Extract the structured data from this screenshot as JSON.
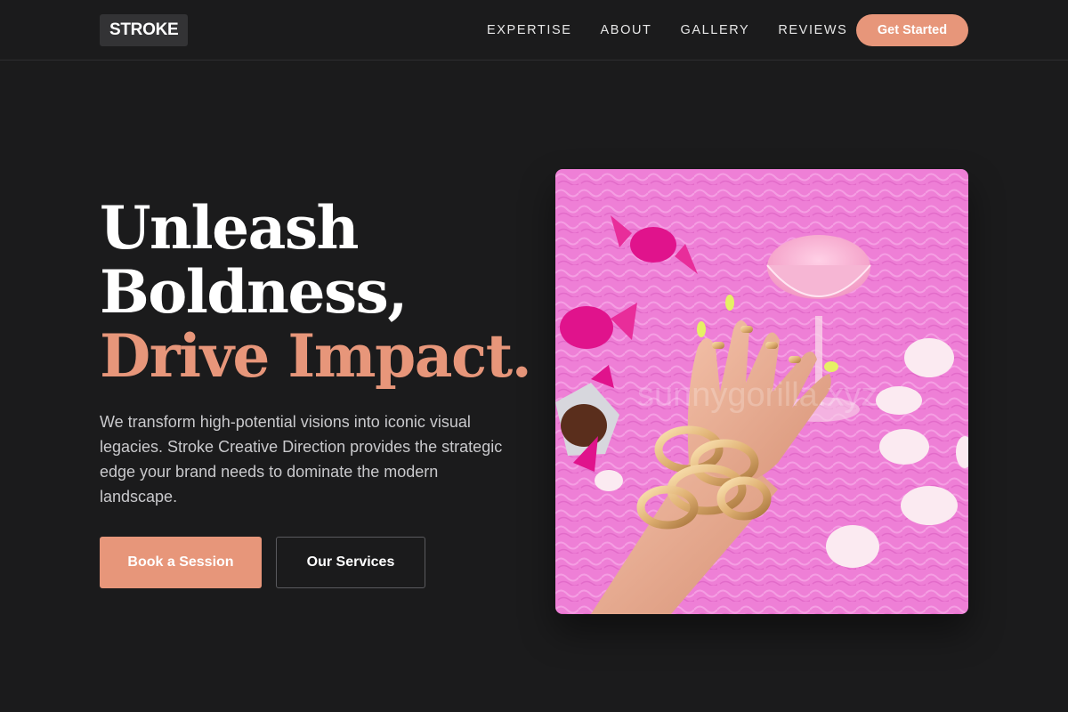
{
  "brand": {
    "logo_text": "STROKE"
  },
  "nav": {
    "links": [
      {
        "label": "EXPERTISE"
      },
      {
        "label": "ABOUT"
      },
      {
        "label": "GALLERY"
      },
      {
        "label": "REVIEWS"
      }
    ],
    "cta_label": "Get Started"
  },
  "hero": {
    "headline_line1": "Unleash",
    "headline_line2": "Boldness,",
    "headline_accent": "Drive Impact.",
    "description": "We transform high-potential visions into iconic visual legacies. Stroke Creative Direction provides the strategic edge your brand needs to dominate the modern landscape.",
    "primary_button": "Book a Session",
    "secondary_button": "Our Services",
    "image_watermark": "sunnygorilla.xyz"
  },
  "colors": {
    "background": "#1b1b1c",
    "accent": "#e7967a",
    "text": "#ffffff",
    "muted_text": "#c9c9cc",
    "image_pink": "#f07fd6"
  }
}
